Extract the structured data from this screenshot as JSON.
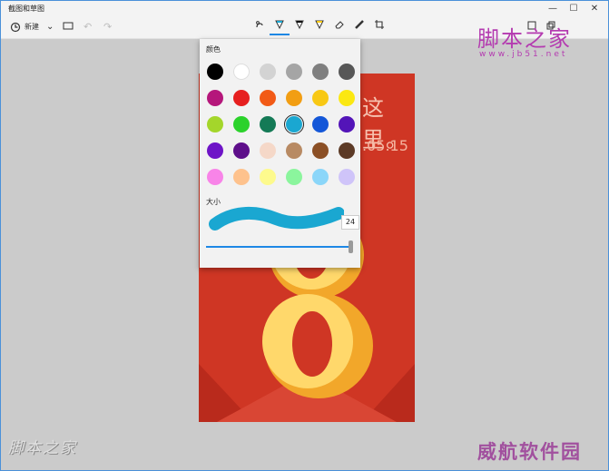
{
  "window": {
    "title": "截图和草图",
    "min": "—",
    "max": "☐",
    "close": "✕"
  },
  "toolbar": {
    "new_label": "新建",
    "chevron": "⌄"
  },
  "popup": {
    "color_heading": "颜色",
    "size_heading": "大小",
    "size_value": "24"
  },
  "colors": [
    [
      "#000000",
      "#ffffff",
      "#d3d3d3",
      "#a5a5a5",
      "#7f7f7f",
      "#575757"
    ],
    [
      "#b5177b",
      "#e61f1f",
      "#f25a16",
      "#f29e13",
      "#f8c814",
      "#fbe812"
    ],
    [
      "#a4d62b",
      "#2bd22b",
      "#147a56",
      "#1aa7d1",
      "#1457d8",
      "#5314b8"
    ],
    [
      "#6e14c7",
      "#5e0f8a",
      "#f5d8c8",
      "#b88a63",
      "#8b4f25",
      "#5c3a26"
    ],
    [
      "#f884e8",
      "#fec28d",
      "#fdfa8d",
      "#8bf59d",
      "#8bd6f9",
      "#cfc4f9"
    ]
  ],
  "selected_color": "#1aa7d1",
  "poster": {
    "line1": "这里。",
    "line2": ".05.15"
  },
  "watermarks": {
    "top": "脚本之家",
    "url": "www.jb51.net",
    "bottom_left": "脚本之家",
    "bottom_right": "威航软件园"
  }
}
